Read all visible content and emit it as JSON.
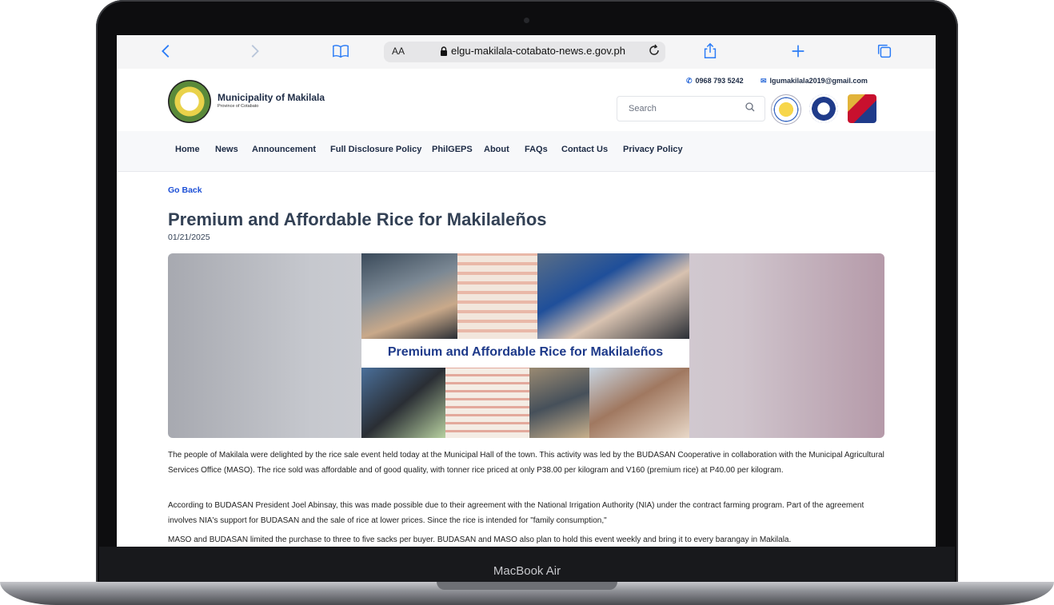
{
  "device": {
    "label": "MacBook Air"
  },
  "browser": {
    "text_size_label": "AA",
    "url": "elgu-makilala-cotabato-news.e.gov.ph"
  },
  "site": {
    "name": "Municipality of Makilala",
    "province": "Province of Cotabato",
    "phone": "0968 793 5242",
    "email": "lgumakilala2019@gmail.com",
    "search_placeholder": "Search"
  },
  "nav": {
    "items": [
      "Home",
      "News",
      "Announcement",
      "Full Disclosure Policy",
      "PhilGEPS",
      "About",
      "FAQs",
      "Contact Us",
      "Privacy Policy"
    ]
  },
  "article": {
    "back_label": "Go Back",
    "title": "Premium and Affordable Rice for Makilaleños",
    "date": "01/21/2025",
    "banner_text": "Premium and Affordable Rice for Makilaleños",
    "paragraphs": [
      "The people of Makilala were delighted by the rice sale event held today at the Municipal Hall of the town. This activity was led by the BUDASAN Cooperative in collaboration with the Municipal Agricultural Services Office (MASO). The rice sold was affordable and of good quality, with tonner rice priced at only P38.00 per kilogram and V160 (premium rice) at P40.00 per kilogram.",
      "According to BUDASAN President Joel Abinsay, this was made possible due to their agreement with the National Irrigation Authority (NIA) under the contract farming program. Part of the agreement involves NIA's support for BUDASAN and the sale of rice at lower prices. Since the rice is intended for \"family consumption,\"",
      "MASO and BUDASAN limited the purchase to three to five sacks per buyer. BUDASAN and MASO also plan to hold this event weekly and bring it to every barangay in Makilala."
    ]
  },
  "colors": {
    "link": "#1c4fd6",
    "brand_text": "#1d2b45",
    "safari_blue": "#2b7cf6"
  }
}
